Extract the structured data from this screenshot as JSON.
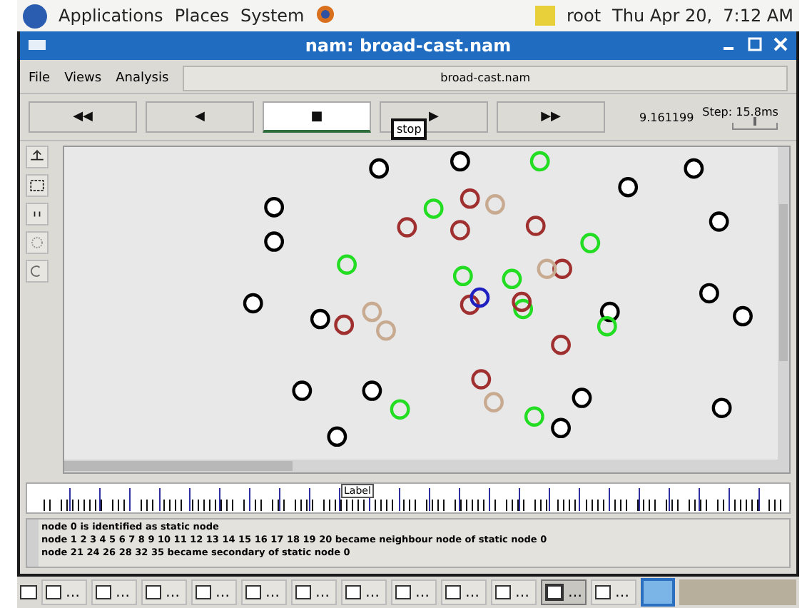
{
  "top_panel": {
    "menus": [
      "Applications",
      "Places",
      "System"
    ],
    "user": "root",
    "clock": "Thu Apr 20,  7:12 AM"
  },
  "window": {
    "title": "nam: broad-cast.nam"
  },
  "menu_bar": {
    "items": [
      "File",
      "Views",
      "Analysis"
    ],
    "file_name": "broad-cast.nam"
  },
  "playback": {
    "buttons": [
      {
        "symbol": "◀◀",
        "selected": false
      },
      {
        "symbol": "◀",
        "selected": false
      },
      {
        "symbol": "■",
        "selected": true
      },
      {
        "symbol": "▶",
        "selected": false
      },
      {
        "symbol": "▶▶",
        "selected": false
      }
    ],
    "tooltip": "stop",
    "time": "9.161199",
    "step": "Step: 15.8ms",
    "step_slider": {
      "level": 0.5
    }
  },
  "canvas": {
    "nodes": [
      {
        "color": "#000000"
      },
      {
        "color": "#000000"
      },
      {
        "color": "#000000"
      },
      {
        "color": "#000000"
      },
      {
        "color": "#000000"
      },
      {
        "color": "#000000"
      },
      {
        "color": "#000000"
      },
      {
        "color": "#000000"
      },
      {
        "color": "#22dd22"
      },
      {
        "color": "#a03030"
      },
      {
        "color": "#c8aa90"
      },
      {
        "color": "#c8aa90"
      },
      {
        "color": "#000000"
      },
      {
        "color": "#000000"
      },
      {
        "color": "#000000"
      },
      {
        "color": "#000000"
      },
      {
        "color": "#000000"
      },
      {
        "color": "#000000"
      },
      {
        "color": "#000000"
      },
      {
        "color": "#000000"
      },
      {
        "color": "#000000"
      },
      {
        "color": "#000000"
      },
      {
        "color": "#22dd22"
      },
      {
        "color": "#22dd22"
      },
      {
        "color": "#22dd22"
      },
      {
        "color": "#22dd22"
      },
      {
        "color": "#22dd22"
      },
      {
        "color": "#22dd22"
      },
      {
        "color": "#22dd22"
      },
      {
        "color": "#22dd22"
      },
      {
        "color": "#22dd22"
      },
      {
        "color": "#a03030"
      },
      {
        "color": "#a03030"
      },
      {
        "color": "#a03030"
      },
      {
        "color": "#a03030"
      },
      {
        "color": "#a03030"
      },
      {
        "color": "#a03030"
      },
      {
        "color": "#a03030"
      },
      {
        "color": "#a03030"
      },
      {
        "color": "#a03030"
      },
      {
        "color": "#c8aa90"
      },
      {
        "color": "#c8aa90"
      },
      {
        "color": "#c8aa90"
      },
      {
        "color": "#2020c0"
      }
    ]
  },
  "timeline": {
    "label": "Label"
  },
  "log": {
    "lines": [
      "node 0 is identified as static node",
      "node 1 2 3 4 5 6 7 8 9 10 11 12 13 14 15 16 17 18 19 20 became neighbour node of static node 0",
      "node 21 24 26 28 32 35 became secondary of static node 0"
    ]
  },
  "taskbar": {
    "items": [
      {
        "label": "…",
        "selected": false
      },
      {
        "label": "…",
        "selected": false
      },
      {
        "label": "…",
        "selected": false
      },
      {
        "label": "…",
        "selected": false
      },
      {
        "label": "…",
        "selected": false
      },
      {
        "label": "…",
        "selected": false
      },
      {
        "label": "…",
        "selected": false
      },
      {
        "label": "…",
        "selected": false
      },
      {
        "label": "…",
        "selected": false
      },
      {
        "label": "…",
        "selected": false
      },
      {
        "label": "…",
        "selected": true
      },
      {
        "label": "…",
        "selected": false
      }
    ]
  }
}
